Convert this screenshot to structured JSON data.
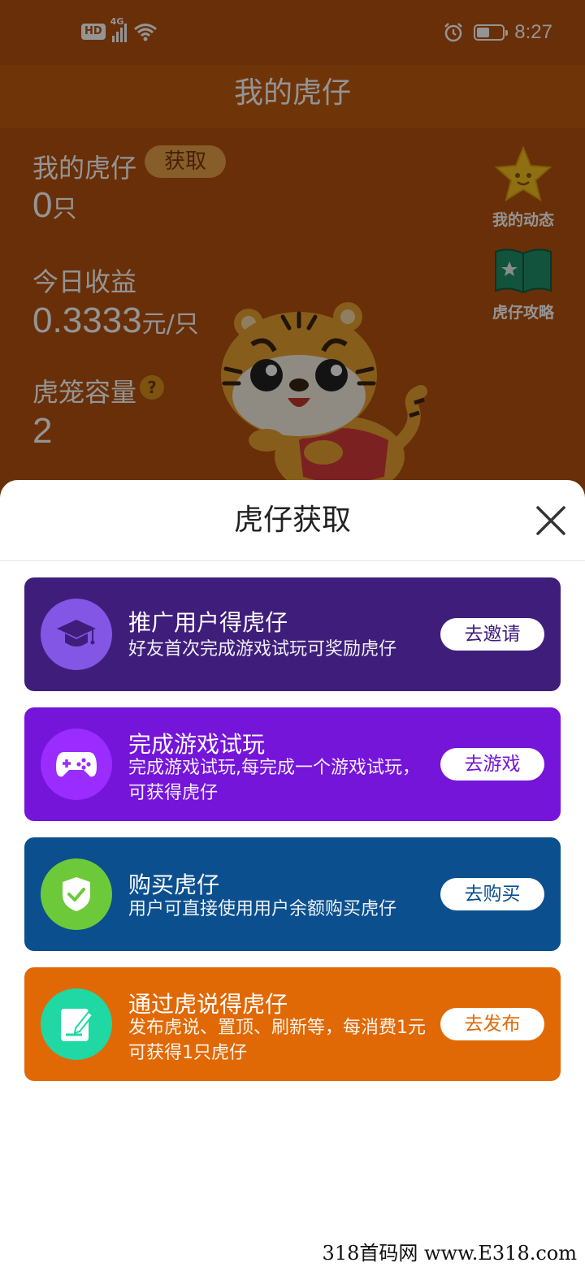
{
  "status_bar": {
    "hd": "HD",
    "network": "4G",
    "time": "8:27",
    "battery_level": 0.5
  },
  "page": {
    "title": "我的虎仔",
    "my_tiger": {
      "label": "我的虎仔",
      "get_label": "获取",
      "value": "0",
      "unit": "只"
    },
    "today_income": {
      "label": "今日收益",
      "value": "0.3333",
      "unit": "元/只"
    },
    "cage_capacity": {
      "label": "虎笼容量",
      "help": "?",
      "value": "2"
    },
    "side_actions": [
      {
        "label": "我的动态",
        "icon": "star-icon"
      },
      {
        "label": "虎仔攻略",
        "icon": "book-icon"
      }
    ]
  },
  "sheet": {
    "title": "虎仔获取",
    "cards": [
      {
        "title": "推广用户得虎仔",
        "desc": "好友首次完成游戏试玩可奖励虎仔",
        "button": "去邀请",
        "icon": "graduation-cap-icon",
        "bg_color": "#3f1e7b",
        "icon_bg": "#8456e6",
        "btn_color": "#3f1e7b"
      },
      {
        "title": "完成游戏试玩",
        "desc": "完成游戏试玩,每完成一个游戏试玩，可获得虎仔",
        "button": "去游戏",
        "icon": "gamepad-icon",
        "bg_color": "#7415d9",
        "icon_bg": "#9a2cff",
        "btn_color": "#7415d9"
      },
      {
        "title": "购买虎仔",
        "desc": "用户可直接使用用户余额购买虎仔",
        "button": "去购买",
        "icon": "shield-check-icon",
        "bg_color": "#0b4f8e",
        "icon_bg": "#6cc93a",
        "btn_color": "#0b4f8e"
      },
      {
        "title": "通过虎说得虎仔",
        "desc": "发布虎说、置顶、刷新等，每消费1元可获得1只虎仔",
        "button": "去发布",
        "icon": "edit-note-icon",
        "bg_color": "#e06905",
        "icon_bg": "#1fd8a4",
        "btn_color": "#e06905"
      }
    ]
  },
  "watermark": "318首码网  www.E318.com"
}
